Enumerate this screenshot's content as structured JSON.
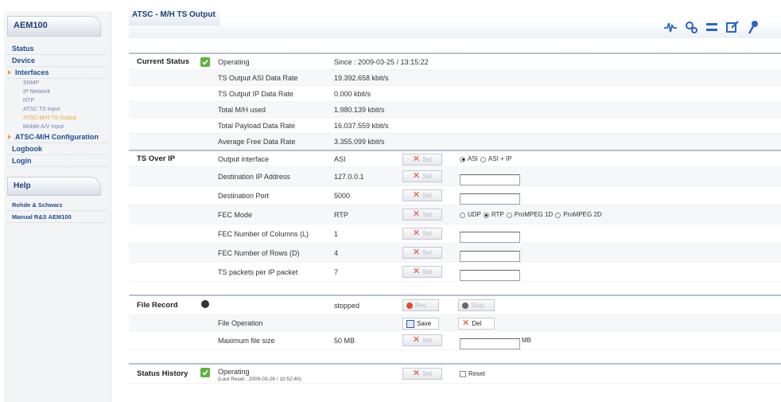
{
  "sidebar": {
    "title": "AEM100",
    "items": [
      {
        "label": "Status"
      },
      {
        "label": "Device"
      },
      {
        "label": "Interfaces"
      },
      {
        "label": "SNMP"
      },
      {
        "label": "IP Network"
      },
      {
        "label": "NTP"
      },
      {
        "label": "ATSC TS Input"
      },
      {
        "label": "ATSC-M/H TS Output"
      },
      {
        "label": "Mobile A/V Input"
      },
      {
        "label": "ATSC-M/H Configuration"
      },
      {
        "label": "Logbook"
      },
      {
        "label": "Login"
      }
    ],
    "help_title": "Help",
    "help_items": [
      {
        "label": "Rohde & Schwarz"
      },
      {
        "label": "Manual R&S AEM100"
      }
    ]
  },
  "header": {
    "title": "ATSC - M/H TS Output",
    "tools": [
      "signal-icon",
      "settings-icon",
      "transfer-icon",
      "edit-icon",
      "key-icon"
    ]
  },
  "current_status": {
    "section": "Current Status",
    "state": "Operating",
    "since": "Since : 2009-03-25 / 13:15:22",
    "rows": [
      {
        "label": "TS Output ASI Data Rate",
        "value": "19.392.658 kbit/s"
      },
      {
        "label": "TS Output IP Data Rate",
        "value": "0.000 kbit/s"
      },
      {
        "label": "Total M/H used",
        "value": "1.980.139 kbit/s"
      },
      {
        "label": "Total Payload Data Rate",
        "value": "16.037.559 kbit/s"
      },
      {
        "label": "Average Free Data Rate",
        "value": "3.355.099 kbit/s"
      }
    ]
  },
  "ts_over_ip": {
    "section": "TS Over IP",
    "set_label": "Set",
    "output_interface": {
      "label": "Output interface",
      "value": "ASI",
      "options": [
        "ASI",
        "ASI + IP"
      ],
      "selected": "ASI"
    },
    "destination_ip": {
      "label": "Destination IP Address",
      "value": "127.0.0.1"
    },
    "destination_port": {
      "label": "Destination Port",
      "value": "5000"
    },
    "fec_mode": {
      "label": "FEC Mode",
      "value": "RTP",
      "options": [
        "UDP",
        "RTP",
        "ProMPEG 1D",
        "ProMPEG 2D"
      ],
      "selected": "RTP"
    },
    "fec_columns": {
      "label": "FEC Number of Columns (L)",
      "value": "1"
    },
    "fec_rows": {
      "label": "FEC Number of Rows (D)",
      "value": "4"
    },
    "ts_packets": {
      "label": "TS packets per IP packet",
      "value": "7"
    }
  },
  "file_record": {
    "section": "File Record",
    "state": "stopped",
    "rec_label": "Rec",
    "stop_label": "Stop",
    "file_operation": {
      "label": "File Operation",
      "save_label": "Save",
      "del_label": "Del"
    },
    "max_size": {
      "label": "Maximum file size",
      "value": "50 MB",
      "unit": "MB",
      "set_label": "Set"
    }
  },
  "status_history": {
    "section": "Status History",
    "state": "Operating",
    "last_reset": "(Last Reset : 2009-03-26 / 10:52:40)",
    "set_label": "Set",
    "reset_label": "Reset"
  },
  "colors": {
    "accent": "#1e4c93",
    "active": "#f0a73a",
    "ok": "#5fb13e",
    "error": "#e3473a"
  }
}
